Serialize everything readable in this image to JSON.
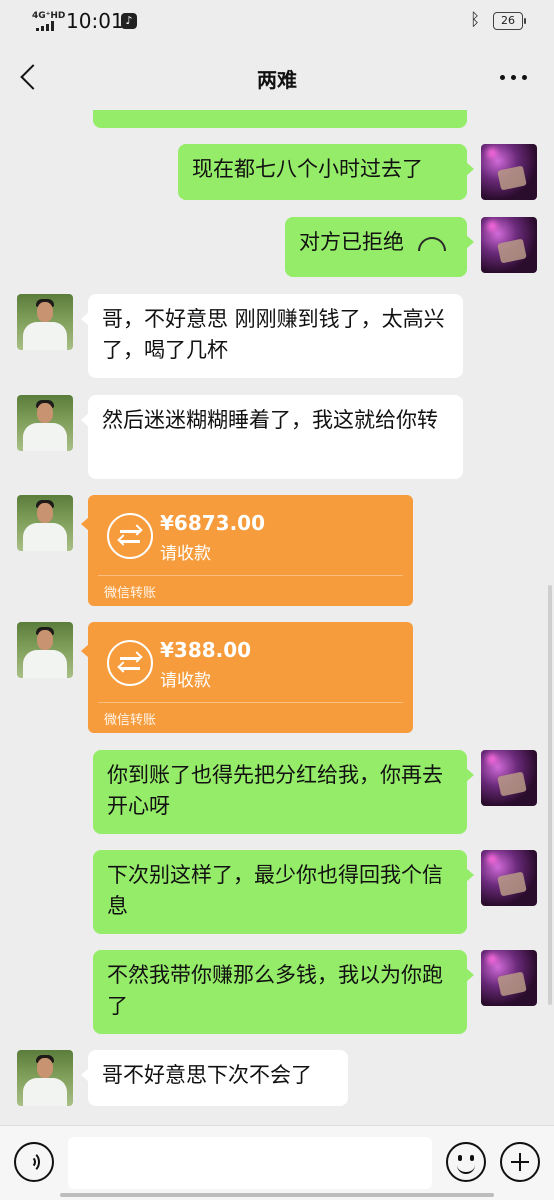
{
  "status_bar": {
    "network": "4G⁺HD",
    "time": "10:01",
    "battery": "26"
  },
  "nav": {
    "title": "两难"
  },
  "messages": [
    {
      "side": "right",
      "type": "text",
      "text": "现在都七八个小时过去了"
    },
    {
      "side": "right",
      "type": "call",
      "text": "对方已拒绝"
    },
    {
      "side": "left",
      "type": "text",
      "text": "哥，不好意思 刚刚赚到钱了，太高兴了，喝了几杯"
    },
    {
      "side": "left",
      "type": "text",
      "text": "然后迷迷糊糊睡着了，我这就给你转"
    },
    {
      "side": "left",
      "type": "transfer",
      "amount": "¥6873.00",
      "status": "请收款",
      "footer": "微信转账"
    },
    {
      "side": "left",
      "type": "transfer",
      "amount": "¥388.00",
      "status": "请收款",
      "footer": "微信转账"
    },
    {
      "side": "right",
      "type": "text",
      "text": "你到账了也得先把分红给我，你再去开心呀"
    },
    {
      "side": "right",
      "type": "text",
      "text": "下次别这样了，最少你也得回我个信息"
    },
    {
      "side": "right",
      "type": "text",
      "text": "不然我带你赚那么多钱，我以为你跑了"
    },
    {
      "side": "left",
      "type": "text",
      "text": "哥不好意思下次不会了"
    }
  ],
  "input": {
    "value": "",
    "placeholder": ""
  },
  "icons": {
    "back": "chevron-left-icon",
    "more": "more-icon",
    "voice": "voice-icon",
    "emoji": "emoji-icon",
    "plus": "plus-icon",
    "call": "phone-hangup-icon",
    "transfer": "transfer-icon"
  },
  "colors": {
    "background": "#ededed",
    "sent_bubble": "#95ec69",
    "received_bubble": "#ffffff",
    "transfer_card": "#f79c3c"
  }
}
